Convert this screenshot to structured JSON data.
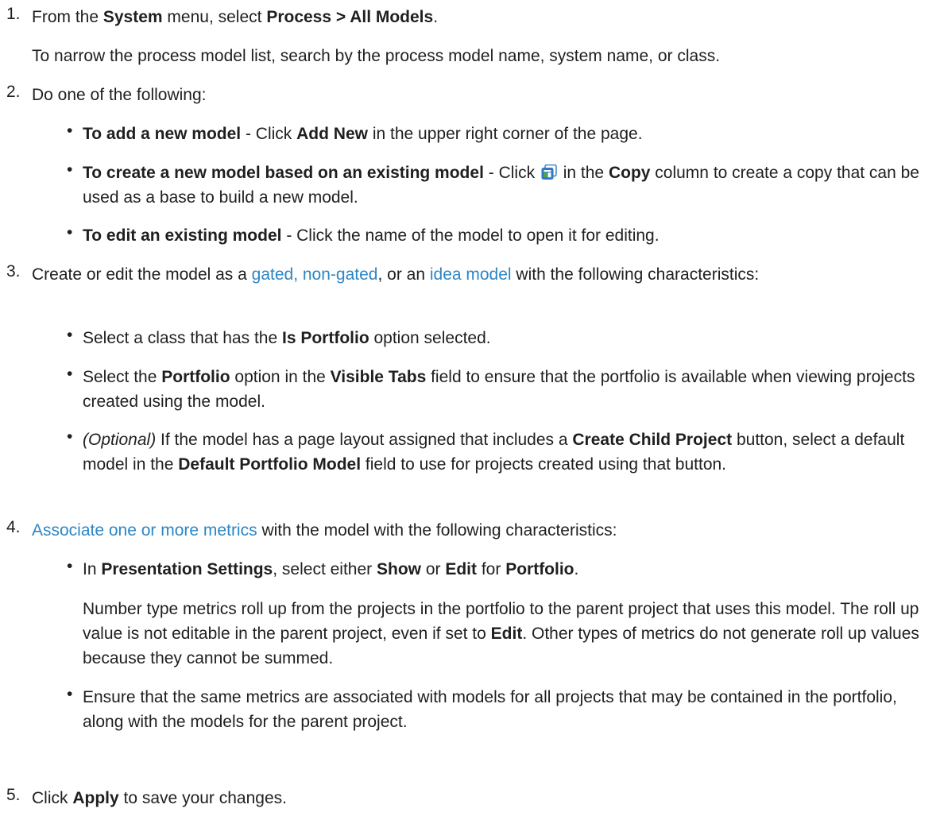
{
  "steps": [
    {
      "num": "1.",
      "text": [
        {
          "t": "From the "
        },
        {
          "t": "System",
          "b": true
        },
        {
          "t": " menu, select "
        },
        {
          "t": "Process > All Models",
          "b": true
        },
        {
          "t": "."
        }
      ],
      "note": "To narrow the process model list, search by the process model name, system name, or class."
    },
    {
      "num": "2.",
      "text": [
        {
          "t": "Do one of the following:"
        }
      ],
      "bullets": [
        [
          {
            "t": "To add a new model",
            "b": true
          },
          {
            "t": " - Click "
          },
          {
            "t": "Add New",
            "b": true
          },
          {
            "t": " in the upper right corner of the page."
          }
        ],
        [
          {
            "t": "To create a new model based on an existing model",
            "b": true
          },
          {
            "t": " - Click "
          },
          {
            "icon": "copy-icon"
          },
          {
            "t": " in the "
          },
          {
            "t": "Copy",
            "b": true
          },
          {
            "t": " column to create a copy that can be used as a base to build a new model."
          }
        ],
        [
          {
            "t": "To edit an existing model",
            "b": true
          },
          {
            "t": " - Click the name of the model to open it for editing."
          }
        ]
      ]
    },
    {
      "num": "3.",
      "text": [
        {
          "t": "Create or edit the model as a "
        },
        {
          "t": "gated, non-gated",
          "link": true
        },
        {
          "t": ", or an "
        },
        {
          "t": "idea model",
          "link": true
        },
        {
          "t": " with the following characteristics:"
        }
      ],
      "bullets": [
        [
          {
            "t": "Select a class that has the "
          },
          {
            "t": "Is Portfolio",
            "b": true
          },
          {
            "t": " option selected."
          }
        ],
        [
          {
            "t": "Select the "
          },
          {
            "t": "Portfolio",
            "b": true
          },
          {
            "t": " option in the "
          },
          {
            "t": "Visible Tabs",
            "b": true
          },
          {
            "t": " field to ensure that the portfolio is available when viewing projects created using the model."
          }
        ],
        [
          {
            "t": "(Optional)",
            "i": true
          },
          {
            "t": " If the model has a page layout assigned that includes a "
          },
          {
            "t": "Create Child Project",
            "b": true
          },
          {
            "t": " button, select a default model in the "
          },
          {
            "t": "Default Portfolio Model",
            "b": true
          },
          {
            "t": " field to use for projects created using that button."
          }
        ]
      ]
    },
    {
      "num": "4.",
      "text": [
        {
          "t": "Associate one or more metrics",
          "link": true
        },
        {
          "t": " with the model with the following characteristics:"
        }
      ],
      "bullets": [
        [
          {
            "t": "In "
          },
          {
            "t": "Presentation Settings",
            "b": true
          },
          {
            "t": ", select either "
          },
          {
            "t": "Show",
            "b": true
          },
          {
            "t": " or "
          },
          {
            "t": "Edit",
            "b": true
          },
          {
            "t": " for "
          },
          {
            "t": "Portfolio",
            "b": true
          },
          {
            "t": "."
          }
        ],
        [
          {
            "t": "Ensure that the same metrics are associated with models for all projects that may be contained in the portfolio, along with the models for the parent project."
          }
        ]
      ],
      "bullet_note": [
        {
          "t": "Number type metrics roll up from the projects in the portfolio to the parent project that uses this model. The roll up value is not editable in the parent project, even if set to "
        },
        {
          "t": "Edit",
          "b": true
        },
        {
          "t": ". Other types of metrics do not generate roll up values because they cannot be summed."
        }
      ]
    },
    {
      "num": "5.",
      "text": [
        {
          "t": "Click "
        },
        {
          "t": "Apply",
          "b": true
        },
        {
          "t": " to save your changes."
        }
      ]
    }
  ],
  "bullet_char": "•",
  "colors": {
    "text": "#1f1f1f",
    "link": "#2d86c4",
    "icon_blue": "#2f78c4",
    "icon_green": "#4caa3c"
  }
}
